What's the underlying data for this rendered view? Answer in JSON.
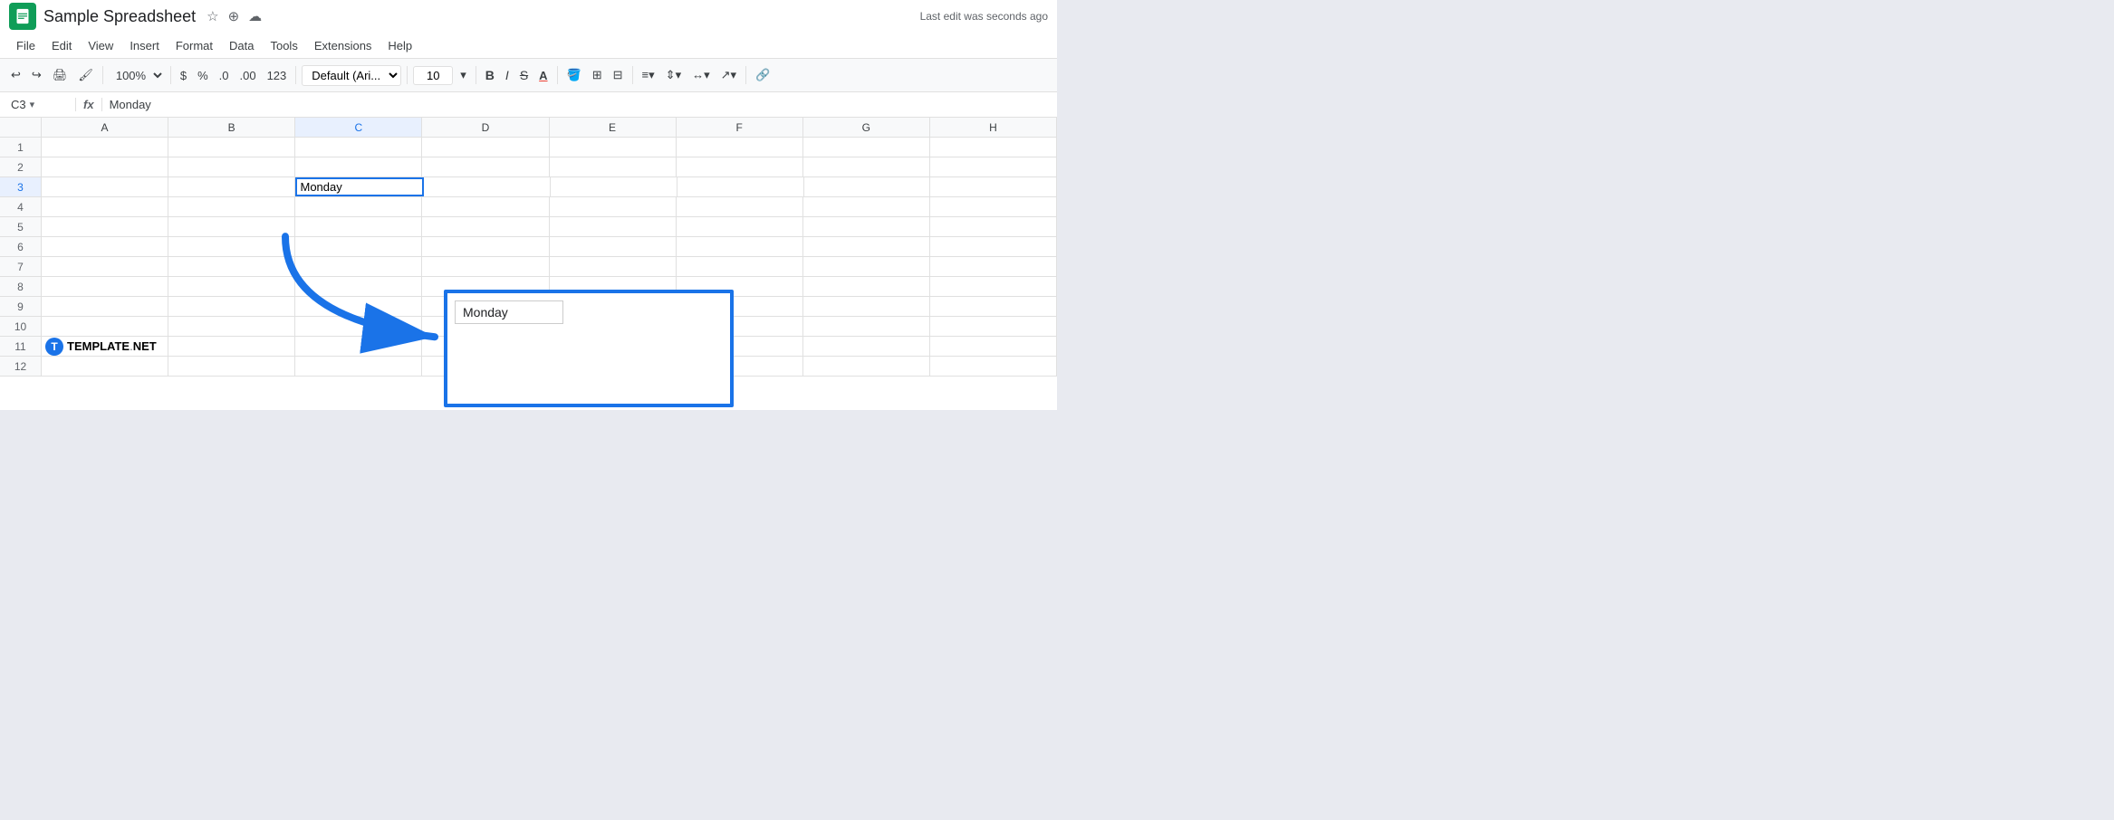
{
  "title": "Sample Spreadsheet",
  "title_icons": [
    "star",
    "folder-move",
    "cloud"
  ],
  "last_edit": "Last edit was seconds ago",
  "menu": {
    "items": [
      "File",
      "Edit",
      "View",
      "Insert",
      "Format",
      "Data",
      "Tools",
      "Extensions",
      "Help"
    ]
  },
  "toolbar": {
    "zoom": "100%",
    "currency": "$",
    "percent": "%",
    "decimal_less": ".0",
    "decimal_more": ".00",
    "number_format": "123",
    "font": "Default (Ari...",
    "font_size": "10",
    "bold": "B",
    "italic": "I",
    "strikethrough": "S",
    "underline_a": "A"
  },
  "formula_bar": {
    "cell_ref": "C3",
    "formula_value": "Monday"
  },
  "columns": [
    "A",
    "B",
    "C",
    "D",
    "E",
    "F",
    "G",
    "H"
  ],
  "rows": [
    1,
    2,
    3,
    4,
    5,
    6,
    7,
    8,
    9,
    10,
    11,
    12
  ],
  "active_cell": {
    "row": 3,
    "col": "C",
    "value": "Monday"
  },
  "magnified": {
    "value": "Monday"
  },
  "template_logo": {
    "t": "T",
    "name": "TEMPLATE",
    "dot": ".",
    "net": "NET"
  },
  "colors": {
    "sheets_green": "#0f9d58",
    "active_blue": "#1a73e8",
    "header_bg": "#f8f9fa",
    "border": "#e0e0e0"
  }
}
